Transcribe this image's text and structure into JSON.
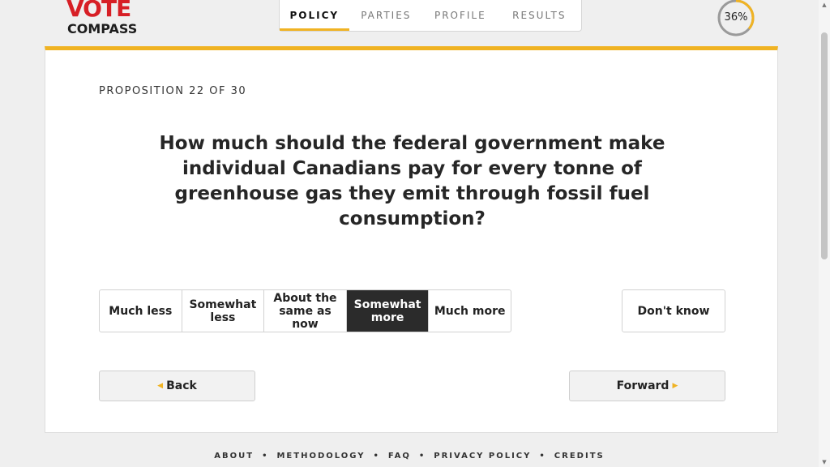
{
  "logo": {
    "line1": "VOTE",
    "line2": "COMPASS"
  },
  "nav": {
    "tabs": [
      {
        "label": "POLICY",
        "active": true
      },
      {
        "label": "PARTIES",
        "active": false
      },
      {
        "label": "PROFILE",
        "active": false
      },
      {
        "label": "RESULTS",
        "active": false
      }
    ]
  },
  "progress": {
    "label": "36%",
    "value": 0.36
  },
  "card": {
    "proposition_count": "PROPOSITION 22 OF 30",
    "question": "How much should the federal government make individual Canadians pay for every tonne of greenhouse gas they emit through fossil fuel consumption?",
    "answers": [
      {
        "label": "Much less",
        "selected": false
      },
      {
        "label": "Somewhat less",
        "selected": false
      },
      {
        "label": "About the same as now",
        "selected": false
      },
      {
        "label": "Somewhat more",
        "selected": true
      },
      {
        "label": "Much more",
        "selected": false
      }
    ],
    "dont_know": "Don't know",
    "back_label": "Back",
    "forward_label": "Forward"
  },
  "footer": {
    "links": [
      "ABOUT",
      "METHODOLOGY",
      "FAQ",
      "PRIVACY POLICY",
      "CREDITS"
    ]
  },
  "colors": {
    "accent": "#f0b323",
    "brand_red": "#d71f26",
    "selected": "#2b2b2b"
  }
}
